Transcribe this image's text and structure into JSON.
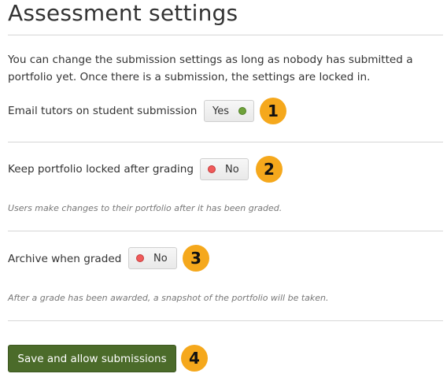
{
  "page": {
    "title": "Assessment settings",
    "intro": "You can change the submission settings as long as nobody has submitted a portfolio yet. Once there is a submission, the settings are locked in."
  },
  "settings": [
    {
      "label": "Email tutors on student submission",
      "value": "Yes",
      "state": "on",
      "callout": "1",
      "help": ""
    },
    {
      "label": "Keep portfolio locked after grading",
      "value": "No",
      "state": "off",
      "callout": "2",
      "help": "Users make changes to their portfolio after it has been graded."
    },
    {
      "label": "Archive when graded",
      "value": "No",
      "state": "off",
      "callout": "3",
      "help": "After a grade has been awarded, a snapshot of the portfolio will be taken."
    }
  ],
  "actions": {
    "save_label": "Save and allow submissions",
    "save_callout": "4"
  },
  "colors": {
    "switch_on_dot": "#6fa23a",
    "switch_off_dot": "#f05a5a",
    "callout_badge": "#f5a81c",
    "primary_button": "#4b6b2a"
  },
  "icons": {
    "on_indicator": "green-dot-icon",
    "off_indicator": "red-dot-icon"
  }
}
